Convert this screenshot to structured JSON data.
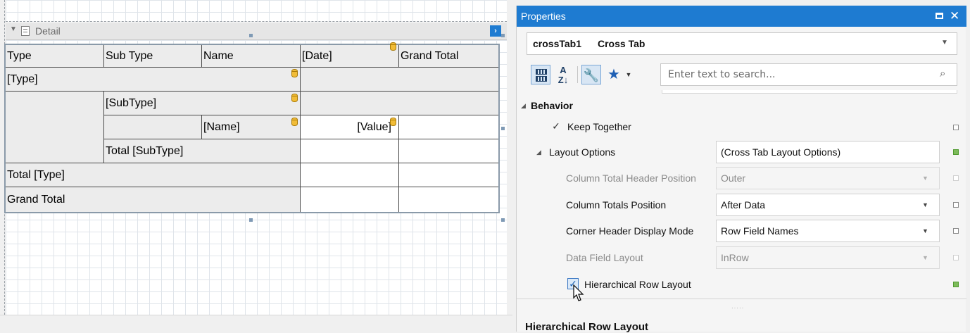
{
  "designer": {
    "band_label": "Detail",
    "crosstab": {
      "header": [
        "Type",
        "Sub Type",
        "Name",
        "[Date]",
        "Grand Total"
      ],
      "row_type": "[Type]",
      "row_subtype": "[SubType]",
      "row_name": "[Name]",
      "cell_value": "[Value]",
      "total_subtype": "Total [SubType]",
      "total_type": "Total [Type]",
      "grand_total": "Grand Total"
    }
  },
  "properties": {
    "title": "Properties",
    "component_name": "crossTab1",
    "component_type": "Cross Tab",
    "search_placeholder": "Enter text to search...",
    "category": "Behavior",
    "rows": {
      "keep_together": "Keep Together",
      "layout_options": "Layout Options",
      "layout_options_value": "(Cross Tab Layout Options)",
      "column_total_header_position": "Column Total Header Position",
      "column_total_header_position_value": "Outer",
      "column_totals_position": "Column Totals Position",
      "column_totals_position_value": "After Data",
      "corner_header_display_mode": "Corner Header Display Mode",
      "corner_header_display_mode_value": "Row Field Names",
      "data_field_layout": "Data Field Layout",
      "data_field_layout_value": "InRow",
      "hierarchical_row_layout": "Hierarchical Row Layout"
    },
    "description_title": "Hierarchical Row Layout"
  },
  "colors": {
    "title_bar": "#1e7bd1",
    "modified_marker": "#7dbb5a"
  }
}
